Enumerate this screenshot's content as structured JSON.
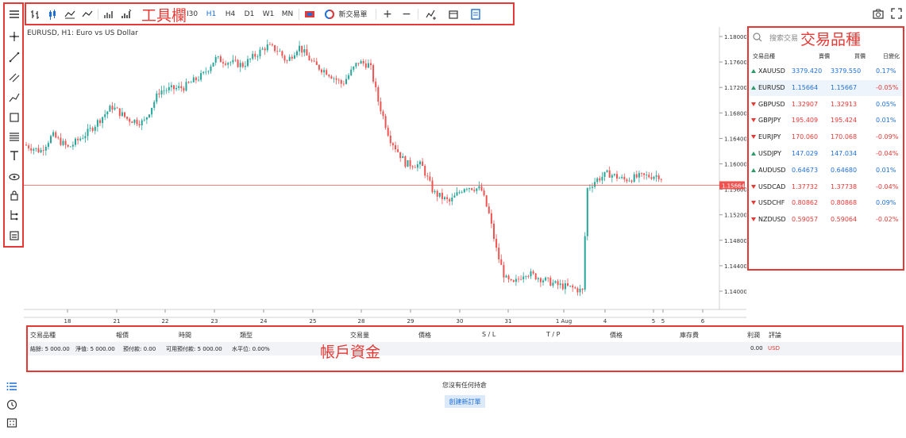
{
  "toolbar": {
    "timeframes": [
      "I30",
      "H1",
      "H4",
      "D1",
      "W1",
      "MN"
    ],
    "active_timeframe": "H1",
    "new_order_label": "新交易單",
    "annotation": "工具欄"
  },
  "chart": {
    "title": "EURUSD, H1: Euro vs US Dollar",
    "current_price": "1.15664",
    "y_ticks": [
      "1.18000",
      "1.17600",
      "1.17200",
      "1.16800",
      "1.16400",
      "1.16000",
      "1.15600",
      "1.15200",
      "1.14800",
      "1.14400",
      "1.14000"
    ],
    "x_ticks": [
      "18",
      "21",
      "22",
      "23",
      "24",
      "25",
      "28",
      "29",
      "30",
      "31",
      "1 Aug",
      "4",
      "5",
      "5",
      "6"
    ]
  },
  "symbols": {
    "search_placeholder": "搜索交易",
    "annotation": "交易品種",
    "headers": {
      "symbol": "交易品種",
      "bid": "賣價",
      "ask": "買價",
      "change": "日變化"
    },
    "rows": [
      {
        "symbol": "XAUUSD",
        "bid": "3379.420",
        "ask": "3379.550",
        "change": "0.17%",
        "dir": "up",
        "bidColor": "#1e6fd9",
        "changeColor": "#1e6fd9"
      },
      {
        "symbol": "EURUSD",
        "bid": "1.15664",
        "ask": "1.15667",
        "change": "-0.05%",
        "dir": "up",
        "bidColor": "#1e6fd9",
        "changeColor": "#e53935"
      },
      {
        "symbol": "GBPUSD",
        "bid": "1.32907",
        "ask": "1.32913",
        "change": "0.05%",
        "dir": "down",
        "bidColor": "#e53935",
        "changeColor": "#1e6fd9"
      },
      {
        "symbol": "GBPJPY",
        "bid": "195.409",
        "ask": "195.424",
        "change": "0.01%",
        "dir": "down",
        "bidColor": "#e53935",
        "changeColor": "#1e6fd9"
      },
      {
        "symbol": "EURJPY",
        "bid": "170.060",
        "ask": "170.068",
        "change": "-0.09%",
        "dir": "down",
        "bidColor": "#e53935",
        "changeColor": "#e53935"
      },
      {
        "symbol": "USDJPY",
        "bid": "147.029",
        "ask": "147.034",
        "change": "-0.04%",
        "dir": "up",
        "bidColor": "#1e6fd9",
        "changeColor": "#e53935"
      },
      {
        "symbol": "AUDUSD",
        "bid": "0.64673",
        "ask": "0.64680",
        "change": "0.01%",
        "dir": "up",
        "bidColor": "#1e6fd9",
        "changeColor": "#1e6fd9"
      },
      {
        "symbol": "USDCAD",
        "bid": "1.37732",
        "ask": "1.37738",
        "change": "-0.04%",
        "dir": "down",
        "bidColor": "#e53935",
        "changeColor": "#e53935"
      },
      {
        "symbol": "USDCHF",
        "bid": "0.80862",
        "ask": "0.80868",
        "change": "0.09%",
        "dir": "down",
        "bidColor": "#e53935",
        "changeColor": "#1e6fd9"
      },
      {
        "symbol": "NZDUSD",
        "bid": "0.59057",
        "ask": "0.59064",
        "change": "-0.02%",
        "dir": "down",
        "bidColor": "#e53935",
        "changeColor": "#e53935"
      }
    ]
  },
  "positions": {
    "annotation": "帳戶資金",
    "headers": {
      "symbol": "交易品種",
      "price": "報價",
      "time": "時間",
      "type": "類型",
      "volume": "交易量",
      "price2": "價格",
      "sl": "S / L",
      "tp": "T / P",
      "price3": "價格",
      "swap": "庫存費",
      "profit": "利潤",
      "comment": "評論"
    },
    "account": {
      "balance": "結餘: 5 000.00",
      "equity": "淨值: 5 000.00",
      "margin": "預付款: 0.00",
      "free_margin": "可用預付款: 5 000.00",
      "level": "水平位: 0.00%",
      "profit": "0.00",
      "currency": "USD"
    },
    "empty_message": "您沒有任何持倉",
    "new_order_button": "創建新訂單"
  }
}
